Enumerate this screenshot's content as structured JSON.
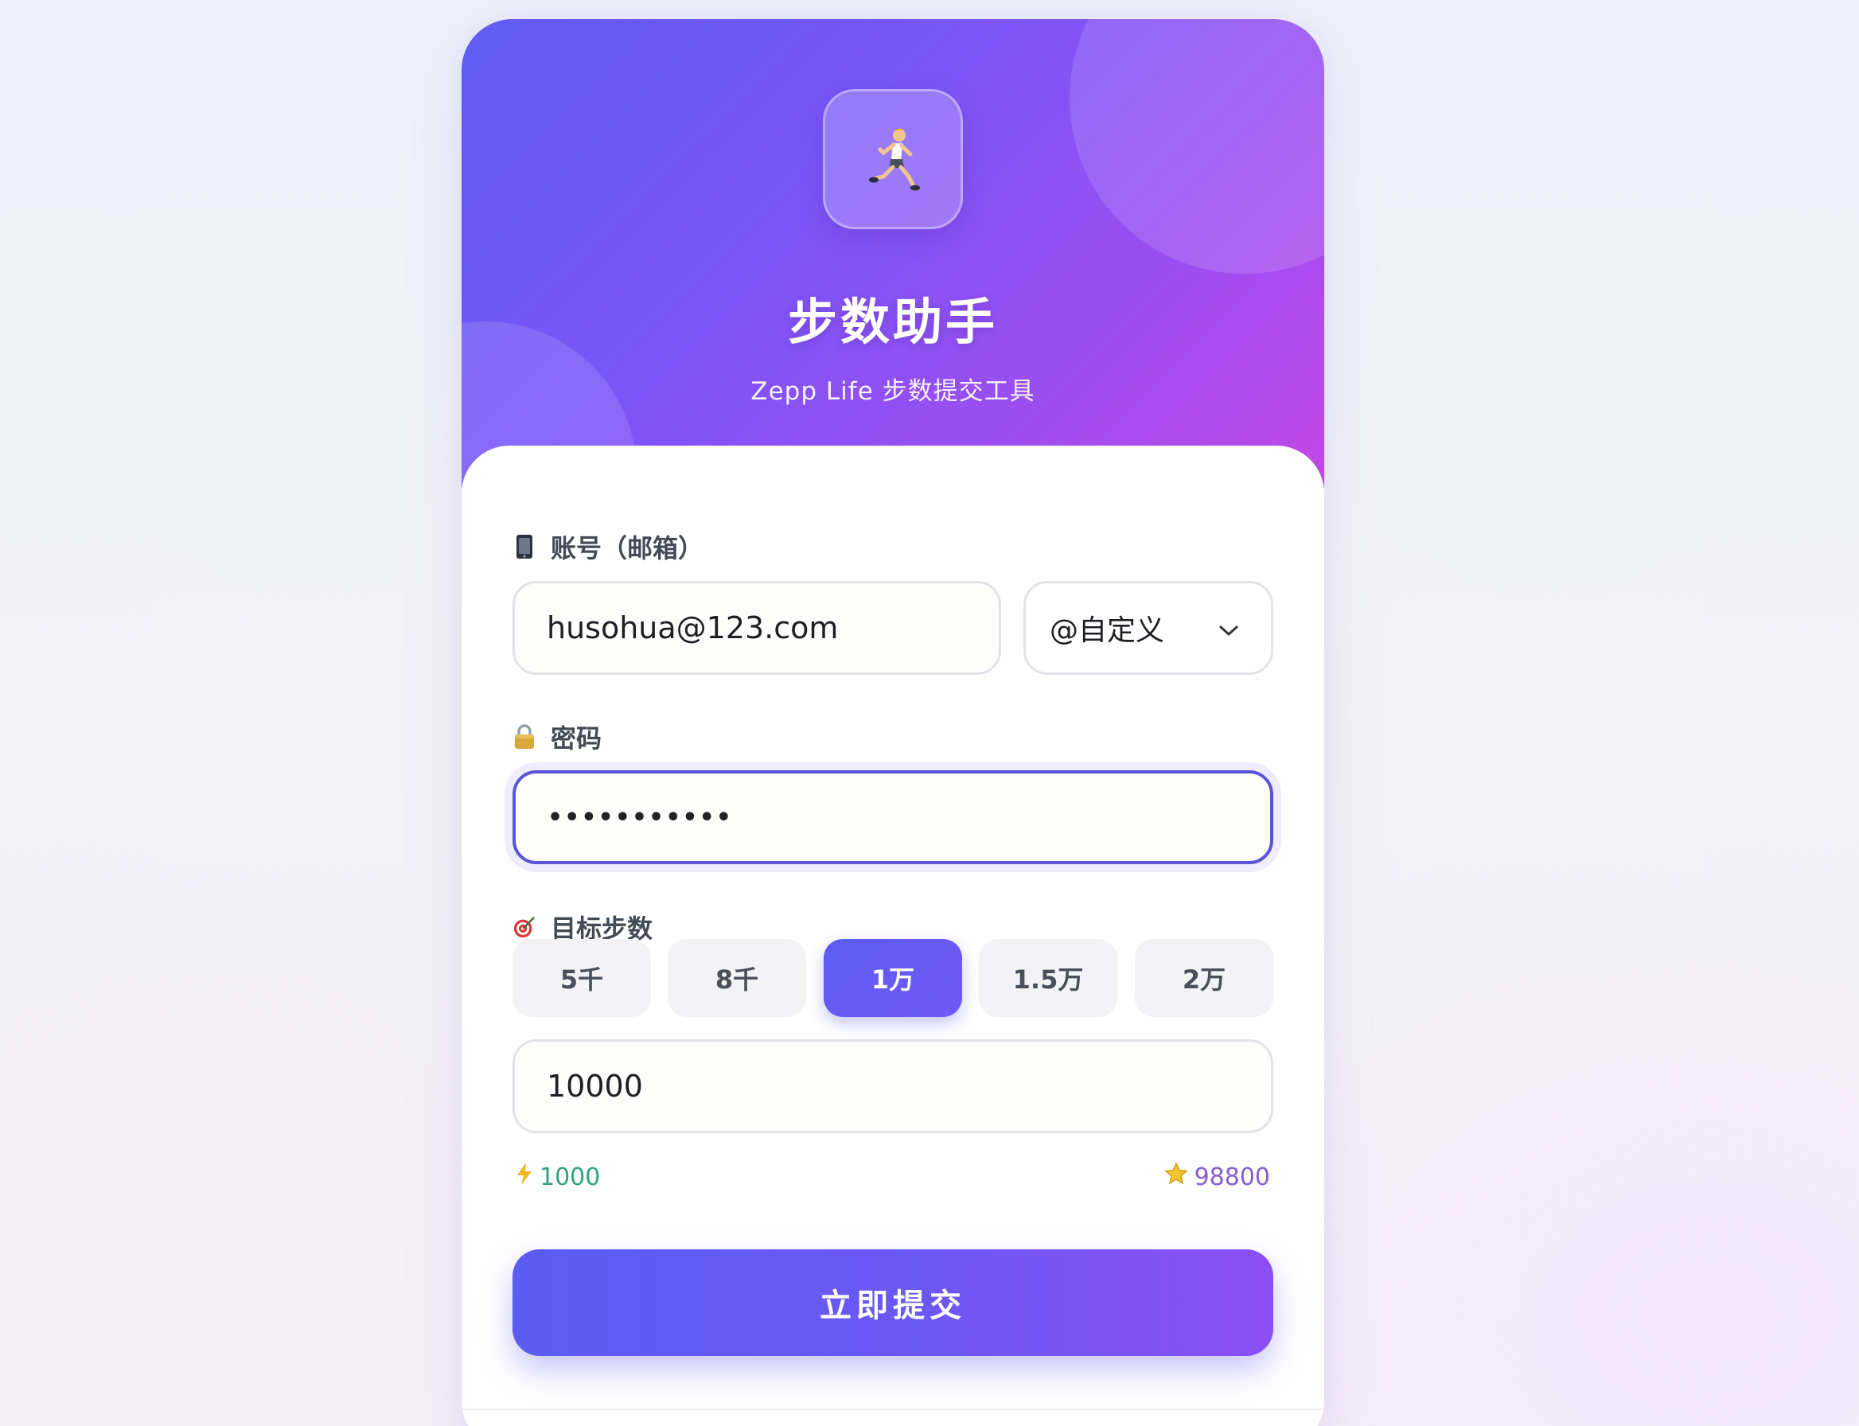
{
  "header": {
    "icon": "runner-icon",
    "title": "步数助手",
    "subtitle": "Zepp Life 步数提交工具"
  },
  "account": {
    "icon": "phone-icon",
    "label": "账号（邮箱）",
    "value": "husohua@123.com",
    "domain_select": "@自定义"
  },
  "password": {
    "icon": "lock-icon",
    "label": "密码",
    "masked_value": "•••••••••••"
  },
  "steps": {
    "icon": "target-icon",
    "label": "目标步数",
    "presets": [
      "5千",
      "8千",
      "1万",
      "1.5万",
      "2万"
    ],
    "active_preset": "1万",
    "value": "10000",
    "min_hint": "1000",
    "max_hint": "98800"
  },
  "submit_label": "立即提交",
  "colors": {
    "accent": "#5c5cf2",
    "gradient_end": "#c347e6",
    "min_hint": "#2fa37a",
    "max_hint": "#8a5ccf"
  }
}
